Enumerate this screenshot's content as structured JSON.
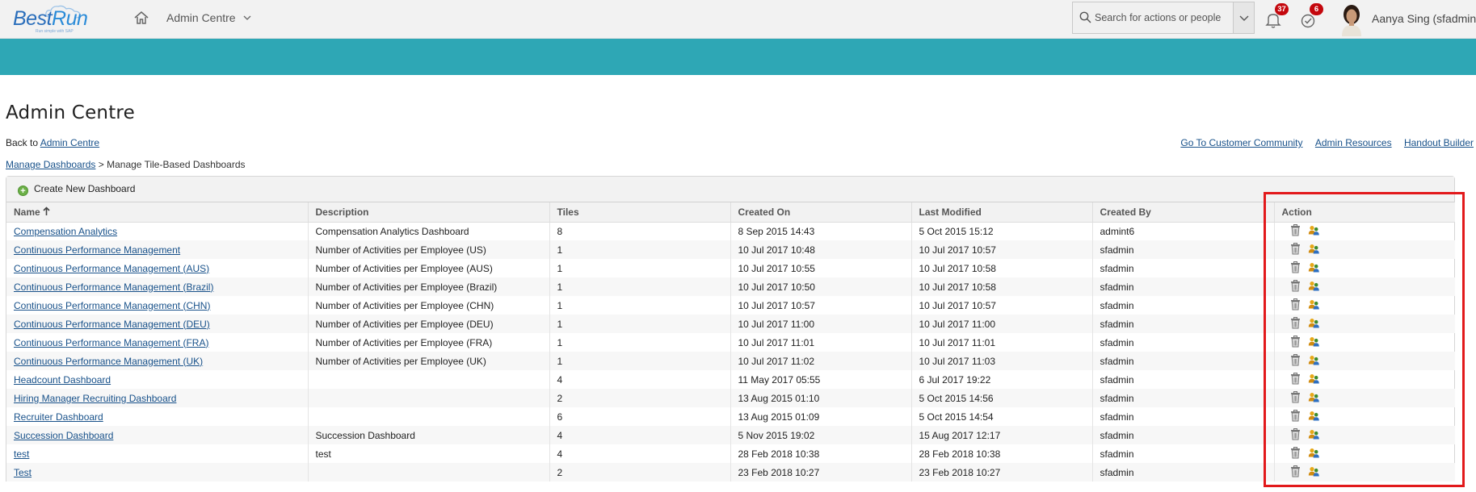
{
  "shell": {
    "logo_text_1": "Best",
    "logo_text_2": "Run",
    "logo_sub": "Run simple with SAP",
    "admin_menu_label": "Admin Centre",
    "search_placeholder": "Search for actions or people",
    "notifications_count": "37",
    "todo_count": "6",
    "user_name": "Aanya Sing (sfadmin)"
  },
  "page": {
    "title": "Admin Centre",
    "back_prefix": "Back to ",
    "back_link": "Admin Centre",
    "top_links": [
      "Go To Customer Community",
      "Admin Resources",
      "Handout Builder"
    ],
    "breadcrumb_link": "Manage Dashboards",
    "breadcrumb_sep": " > ",
    "breadcrumb_current": "Manage Tile-Based Dashboards"
  },
  "toolbar": {
    "create_label": "Create New Dashboard"
  },
  "table": {
    "columns": [
      "Name",
      "Description",
      "Tiles",
      "Created On",
      "Last Modified",
      "Created By",
      "Action"
    ],
    "rows": [
      {
        "name": "Compensation Analytics",
        "description": "Compensation Analytics Dashboard",
        "tiles": "8",
        "created_on": "8 Sep 2015 14:43",
        "last_modified": "5 Oct 2015 15:12",
        "created_by": "admint6"
      },
      {
        "name": "Continuous Performance Management",
        "description": "Number of Activities per Employee (US)",
        "tiles": "1",
        "created_on": "10 Jul 2017 10:48",
        "last_modified": "10 Jul 2017 10:57",
        "created_by": "sfadmin"
      },
      {
        "name": "Continuous Performance Management (AUS)",
        "description": "Number of Activities per Employee (AUS)",
        "tiles": "1",
        "created_on": "10 Jul 2017 10:55",
        "last_modified": "10 Jul 2017 10:58",
        "created_by": "sfadmin"
      },
      {
        "name": "Continuous Performance Management (Brazil)",
        "description": "Number of Activities per Employee (Brazil)",
        "tiles": "1",
        "created_on": "10 Jul 2017 10:50",
        "last_modified": "10 Jul 2017 10:58",
        "created_by": "sfadmin"
      },
      {
        "name": "Continuous Performance Management (CHN)",
        "description": "Number of Activities per Employee (CHN)",
        "tiles": "1",
        "created_on": "10 Jul 2017 10:57",
        "last_modified": "10 Jul 2017 10:57",
        "created_by": "sfadmin"
      },
      {
        "name": "Continuous Performance Management (DEU)",
        "description": "Number of Activities per Employee (DEU)",
        "tiles": "1",
        "created_on": "10 Jul 2017 11:00",
        "last_modified": "10 Jul 2017 11:00",
        "created_by": "sfadmin"
      },
      {
        "name": "Continuous Performance Management (FRA)",
        "description": "Number of Activities per Employee (FRA)",
        "tiles": "1",
        "created_on": "10 Jul 2017 11:01",
        "last_modified": "10 Jul 2017 11:01",
        "created_by": "sfadmin"
      },
      {
        "name": "Continuous Performance Management (UK)",
        "description": "Number of Activities per Employee (UK)",
        "tiles": "1",
        "created_on": "10 Jul 2017 11:02",
        "last_modified": "10 Jul 2017 11:03",
        "created_by": "sfadmin"
      },
      {
        "name": "Headcount Dashboard",
        "description": "",
        "tiles": "4",
        "created_on": "11 May 2017 05:55",
        "last_modified": "6 Jul 2017 19:22",
        "created_by": "sfadmin"
      },
      {
        "name": "Hiring Manager Recruiting Dashboard",
        "description": "",
        "tiles": "2",
        "created_on": "13 Aug 2015 01:10",
        "last_modified": "5 Oct 2015 14:56",
        "created_by": "sfadmin"
      },
      {
        "name": "Recruiter Dashboard",
        "description": "",
        "tiles": "6",
        "created_on": "13 Aug 2015 01:09",
        "last_modified": "5 Oct 2015 14:54",
        "created_by": "sfadmin"
      },
      {
        "name": "Succession Dashboard",
        "description": "Succession Dashboard",
        "tiles": "4",
        "created_on": "5 Nov 2015 19:02",
        "last_modified": "15 Aug 2017 12:17",
        "created_by": "sfadmin"
      },
      {
        "name": "test",
        "description": "test",
        "tiles": "4",
        "created_on": "28 Feb 2018 10:38",
        "last_modified": "28 Feb 2018 10:38",
        "created_by": "sfadmin"
      },
      {
        "name": "Test",
        "description": "",
        "tiles": "2",
        "created_on": "23 Feb 2018 10:27",
        "last_modified": "23 Feb 2018 10:27",
        "created_by": "sfadmin"
      }
    ]
  },
  "icons": {
    "home": "home-icon",
    "search": "search-icon",
    "bell": "bell-icon",
    "todo": "todo-check-icon",
    "delete": "trash-icon",
    "share": "share-users-icon",
    "sort": "sort-ascending-icon"
  },
  "colors": {
    "teal_band": "#2ea7b5",
    "link": "#18518a",
    "badge": "#c4070d",
    "highlight": "#e2191b"
  }
}
